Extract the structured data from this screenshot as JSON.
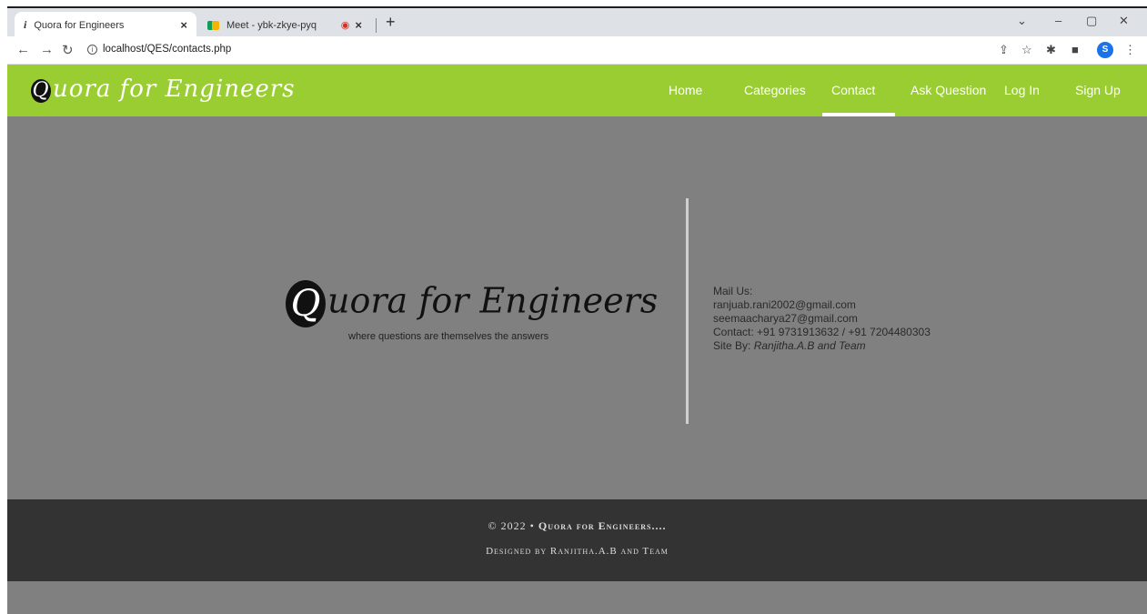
{
  "browser": {
    "tabs": [
      {
        "favicon": "i",
        "title": "Quora for Engineers",
        "close": "×"
      },
      {
        "title": "Meet - ybk-zkye-pyq",
        "rec": "◉",
        "close": "×"
      }
    ],
    "new_tab": "+",
    "url": "localhost/QES/contacts.php",
    "profile_initial": "S"
  },
  "site": {
    "logo_q": "Q",
    "logo_rest": "uora for Engineers",
    "nav": [
      "Home",
      "Categories",
      "Contact",
      "Ask Question",
      "Log In",
      "Sign Up"
    ],
    "active_nav": "Contact"
  },
  "main": {
    "big_logo_q": "Q",
    "big_logo_rest": "uora for Engineers",
    "tagline": "where questions are themselves the answers",
    "contact": {
      "mail_label": "Mail Us:",
      "email1": "ranjuab.rani2002@gmail.com",
      "email2": "seemaacharya27@gmail.com",
      "contact_line": "Contact: +91 9731913632 / +91 7204480303",
      "site_by_label": "Site By: ",
      "site_by": "Ranjitha.A.B and Team"
    }
  },
  "footer": {
    "line1_prefix": "© 2022 • ",
    "line1_name": "Quora for Engineers....",
    "line2": "Designed by Ranjitha.A.B and Team"
  },
  "icons": [
    "back-icon",
    "forward-icon",
    "reload-icon",
    "info-icon",
    "share-icon",
    "star-icon",
    "extensions-icon",
    "sidepanel-icon",
    "menu-icon"
  ]
}
